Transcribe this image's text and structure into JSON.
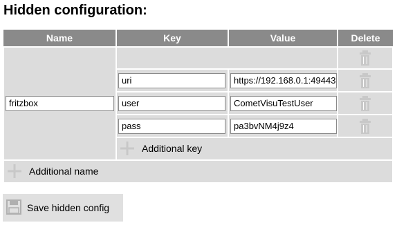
{
  "page": {
    "title": "Hidden configuration:"
  },
  "table": {
    "headers": {
      "name": "Name",
      "key": "Key",
      "value": "Value",
      "delete": "Delete"
    },
    "entry": {
      "name": "fritzbox",
      "rows": [
        {
          "key": "uri",
          "value": "https://192.168.0.1:49443"
        },
        {
          "key": "user",
          "value": "CometVisuTestUser"
        },
        {
          "key": "pass",
          "value": "pa3bvNM4j9z4"
        }
      ],
      "additional_key_label": "Additional key"
    },
    "additional_name_label": "Additional name"
  },
  "actions": {
    "save_label": "Save hidden config"
  },
  "icons": {
    "delete": "trash-icon",
    "add": "plus-icon",
    "save": "floppy-disk-icon"
  },
  "colors": {
    "header_bg": "#8a8a8a",
    "row_bg": "#dcdcdc",
    "button_bg": "#e0e0e0",
    "icon_gray": "#c8c8c8"
  }
}
